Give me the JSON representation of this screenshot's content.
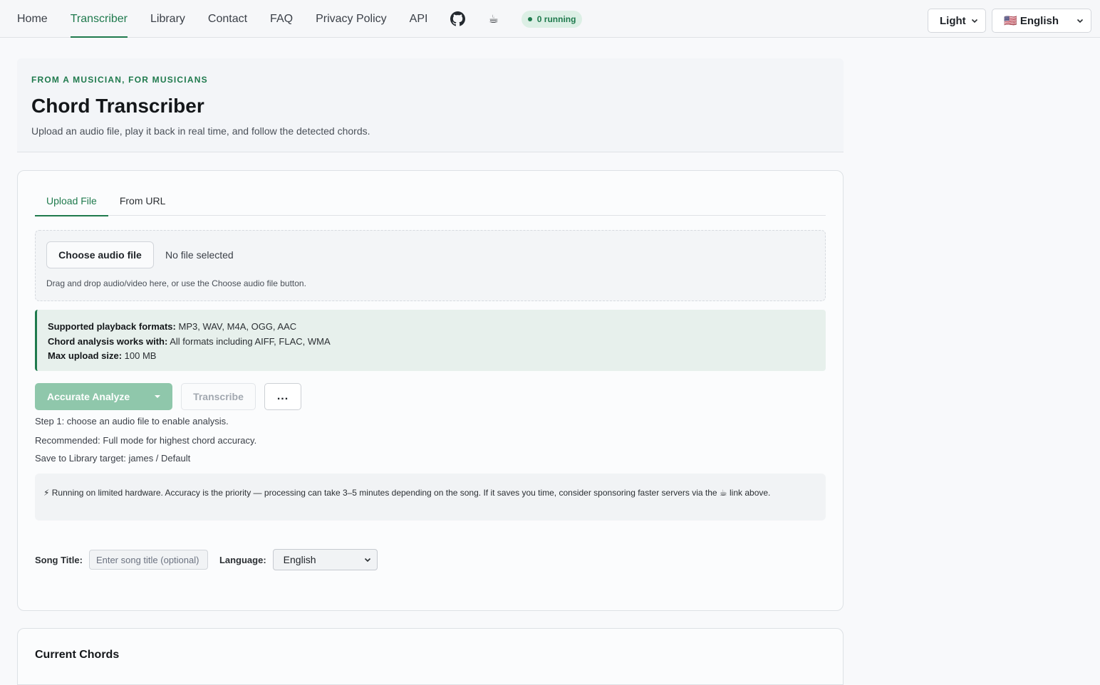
{
  "nav": {
    "links": [
      "Home",
      "Transcriber",
      "Library",
      "Contact",
      "FAQ",
      "Privacy Policy",
      "API"
    ],
    "active": "Transcriber",
    "coffee_glyph": "☕",
    "running_badge": "0 running",
    "theme_select": "Light",
    "language_select": "🇺🇸 English"
  },
  "header": {
    "eyebrow": "FROM A MUSICIAN, FOR MUSICIANS",
    "title": "Chord Transcriber",
    "subtitle": "Upload an audio file, play it back in real time, and follow the detected chords."
  },
  "tabs": [
    "Upload File",
    "From URL"
  ],
  "upload": {
    "choose_button": "Choose audio file",
    "file_status": "No file selected",
    "hint": "Drag and drop audio/video here, or use the Choose audio file button."
  },
  "formats": {
    "playback_label": "Supported playback formats:",
    "playback_value": " MP3, WAV, M4A, OGG, AAC",
    "analysis_label": "Chord analysis works with:",
    "analysis_value": " All formats including AIFF, FLAC, WMA",
    "max_label": "Max upload size:",
    "max_value": " 100 MB"
  },
  "actions": {
    "analyze": "Accurate Analyze",
    "transcribe": "Transcribe",
    "more": "..."
  },
  "status_lines": [
    "Step 1: choose an audio file to enable analysis.",
    "Recommended: Full mode for highest chord accuracy.",
    "Save to Library target: james / Default"
  ],
  "notice": "⚡ Running on limited hardware. Accuracy is the priority — processing can take 3–5 minutes depending on the song. If it saves you time, consider sponsoring faster servers via the ☕ link above.",
  "form": {
    "song_title_label": "Song Title:",
    "song_title_placeholder": "Enter song title (optional)",
    "language_label": "Language:",
    "language_value": "English"
  },
  "chords": {
    "title": "Current Chords"
  },
  "icons": {
    "github": "github-icon",
    "coffee": "coffee-icon",
    "chevron": "chevron-down-icon"
  },
  "colors": {
    "accent": "#1f7a4d",
    "accent_light": "#8fc7ab",
    "badge_bg": "#dcefe5",
    "info_bg": "#e7f0ec"
  }
}
